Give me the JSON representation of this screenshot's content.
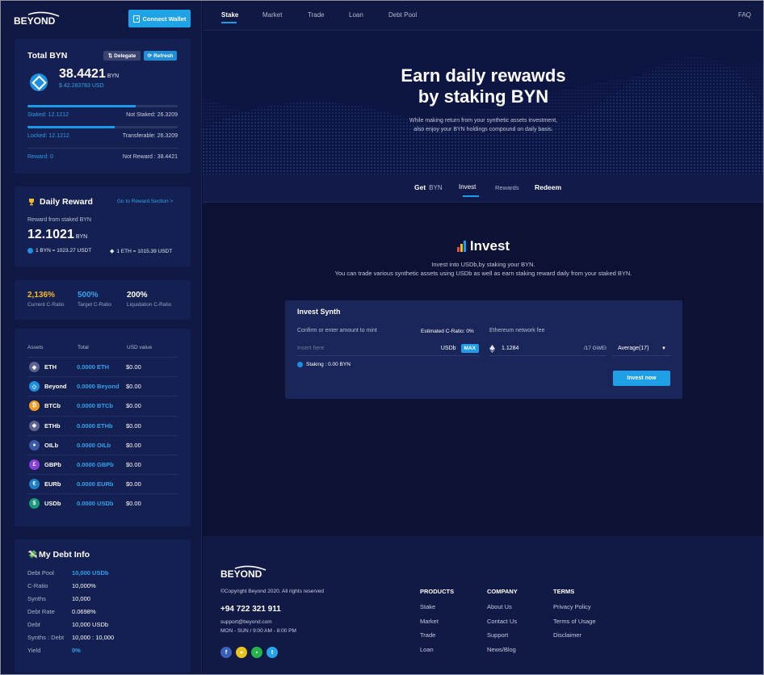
{
  "brand": "BEYOND",
  "sidebar": {
    "connect_wallet": "Connect Wallet",
    "total": {
      "title": "Total BYN",
      "delegate": "Delegate",
      "refresh": "Refresh",
      "amount": "38.4421",
      "unit": "BYN",
      "usd": "$ 42.283783 USD",
      "staked": "Staked: 12.1212",
      "not_staked": "Not Staked: 26.3209",
      "locked": "Locked: 12.1212",
      "transferable": "Transferable: 26.3209",
      "reward": "Reward: 0",
      "not_reward": "Not Reward : 38.4421",
      "staked_fraction": 0.72,
      "locked_fraction": 0.58
    },
    "daily": {
      "title": "Daily Reward",
      "link": "Go to Reward Section >",
      "label": "Reward from staked BYN",
      "amount": "12.1021",
      "unit": "BYN",
      "rate_byn": "1 BYN = 1023.27 USDT",
      "rate_eth": "1 ETH = 1015.39 USDT"
    },
    "ratios": [
      {
        "value": "2,136%",
        "label": "Current C-Ratio",
        "color": "#f5b92a"
      },
      {
        "value": "500%",
        "label": "Target C-Ratio",
        "color": "#2ea3ee"
      },
      {
        "value": "200%",
        "label": "Liquidation C-Ratio",
        "color": "#ffffff"
      }
    ],
    "assets": {
      "headers": [
        "Assets",
        "Total",
        "USD value"
      ],
      "rows": [
        {
          "name": "ETH",
          "total": "0.0000 ETH",
          "usd": "$0.00",
          "color": "#5b6290",
          "glyph": "◆"
        },
        {
          "name": "Beyond",
          "total": "0.0000 Beyond",
          "usd": "$0.00",
          "color": "#1f8fe0",
          "glyph": "◇"
        },
        {
          "name": "BTCb",
          "total": "0.0000 BTCb",
          "usd": "$0.00",
          "color": "#f09a1e",
          "glyph": "₿"
        },
        {
          "name": "ETHb",
          "total": "0.0000 ETHb",
          "usd": "$0.00",
          "color": "#5b6290",
          "glyph": "◆"
        },
        {
          "name": "OILb",
          "total": "0.0000 OILb",
          "usd": "$0.00",
          "color": "#3a5aa6",
          "glyph": "●"
        },
        {
          "name": "GBPb",
          "total": "0.0000 GBPb",
          "usd": "$0.00",
          "color": "#8a3fd6",
          "glyph": "£"
        },
        {
          "name": "EURb",
          "total": "0.0000 EURb",
          "usd": "$0.00",
          "color": "#1f7fc6",
          "glyph": "€"
        },
        {
          "name": "USDb",
          "total": "0.0000 USDb",
          "usd": "$0.00",
          "color": "#1a9a7a",
          "glyph": "$"
        }
      ]
    },
    "debt": {
      "title": "My Debt Info",
      "rows": [
        {
          "label": "Debt Pool",
          "value": "10,000 USDb",
          "blue": true
        },
        {
          "label": "C-Ratio",
          "value": "10,000%",
          "blue": false
        },
        {
          "label": "Synths",
          "value": "10,000",
          "blue": false
        },
        {
          "label": "Debt Rate",
          "value": "0.0698%",
          "blue": false
        },
        {
          "label": "Debt",
          "value": "10,000 USDb",
          "blue": false
        },
        {
          "label": "Synths : Debt",
          "value": "10,000 : 10,000",
          "blue": false
        },
        {
          "label": "Yield",
          "value": "0%",
          "blue": true
        }
      ]
    }
  },
  "nav": {
    "items": [
      "Stake",
      "Market",
      "Trade",
      "Loan",
      "Debt Pool"
    ],
    "faq": "FAQ"
  },
  "hero": {
    "title_line1": "Earn daily rewawds",
    "title_line2": "by staking BYN",
    "sub_line1": "While making return from your synthetic assets investment,",
    "sub_line2": "also enjoy your BYN holdings compound on daily basis."
  },
  "tabs": {
    "get": "Get",
    "get_unit": "BYN",
    "invest": "Invest",
    "rewards": "Rewards",
    "redeem": "Redeem"
  },
  "invest": {
    "title": "Invest",
    "sub_line1": "Invest into USDb,by staking your BYN.",
    "sub_line2": "You can trade various synthetic assets using USDb as well as earn staking reward daily from your staked BYN.",
    "card_title": "Invest Synth",
    "confirm_label": "Confirm or enter amount to mint",
    "est_ratio": "Estimated C-Ratio: 0%",
    "fee_label": "Ethereum network fee",
    "input_placeholder": "Insert here",
    "unit": "USDb",
    "max": "MAX",
    "fee_value": "1.1284",
    "gwei": "/17 GWEI",
    "speed": "Average(17)",
    "staking": "Staking : 0.00 BYN",
    "button": "Invest now"
  },
  "footer": {
    "copyright": "©Copyright Beyond 2020. All rights reserved",
    "phone": "+94 722 321 911",
    "email": "support@beyond.com",
    "hours": "MON - SUN / 9:00 AM - 8:00 PM",
    "columns": [
      {
        "title": "PRODUCTS",
        "links": [
          "Stake",
          "Market",
          "Trade",
          "Loan"
        ]
      },
      {
        "title": "COMPANY",
        "links": [
          "About Us",
          "Contact Us",
          "Support",
          "News/Blog"
        ]
      },
      {
        "title": "TERMS",
        "links": [
          "Privacy Policy",
          "Terms of Usage",
          "Disclaimer"
        ]
      }
    ],
    "socials": [
      {
        "name": "facebook",
        "glyph": "f",
        "color": "#3b5fb8"
      },
      {
        "name": "chat",
        "glyph": "●",
        "color": "#e9c21d"
      },
      {
        "name": "line",
        "glyph": "▪",
        "color": "#28b34a"
      },
      {
        "name": "twitter",
        "glyph": "t",
        "color": "#29a3e8"
      }
    ]
  }
}
